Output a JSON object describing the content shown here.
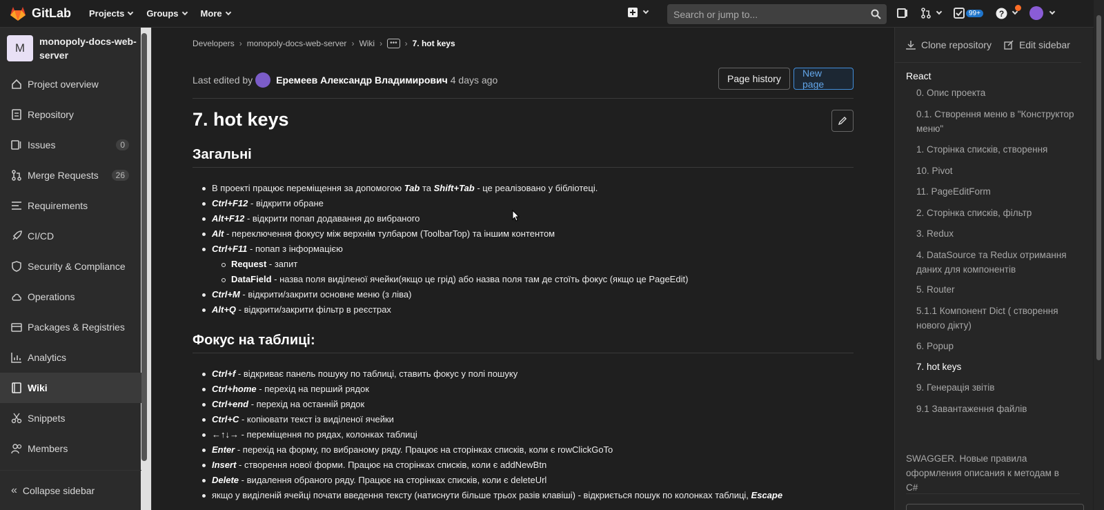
{
  "topbar": {
    "brand": "GitLab",
    "nav": [
      "Projects",
      "Groups",
      "More"
    ],
    "search_placeholder": "Search or jump to...",
    "todo_count": "99+"
  },
  "sidebar": {
    "project_initial": "M",
    "project_name": "monopoly-docs-web-server",
    "items": [
      {
        "label": "Project overview",
        "icon": "home-icon"
      },
      {
        "label": "Repository",
        "icon": "doc-icon"
      },
      {
        "label": "Issues",
        "icon": "issues-icon",
        "count": "0"
      },
      {
        "label": "Merge Requests",
        "icon": "merge-request-icon",
        "count": "26"
      },
      {
        "label": "Requirements",
        "icon": "requirements-icon"
      },
      {
        "label": "CI/CD",
        "icon": "rocket-icon"
      },
      {
        "label": "Security & Compliance",
        "icon": "shield-icon"
      },
      {
        "label": "Operations",
        "icon": "cloud-gear-icon"
      },
      {
        "label": "Packages & Registries",
        "icon": "package-icon"
      },
      {
        "label": "Analytics",
        "icon": "chart-icon"
      },
      {
        "label": "Wiki",
        "icon": "book-icon"
      },
      {
        "label": "Snippets",
        "icon": "scissors-icon"
      },
      {
        "label": "Members",
        "icon": "users-icon"
      }
    ],
    "collapse_label": "Collapse sidebar"
  },
  "breadcrumbs": {
    "items": [
      "Developers",
      "monopoly-docs-web-server",
      "Wiki"
    ],
    "current": "7. hot keys"
  },
  "page": {
    "edited_prefix": "Last edited by",
    "author": "Еремеев Александр Владимирович",
    "edited_time": "4 days ago",
    "history_btn": "Page history",
    "new_page_btn": "New page",
    "title": "7. hot keys"
  },
  "content": {
    "section1_title": "Загальні",
    "section1": [
      {
        "type": "mixed",
        "parts": [
          [
            "",
            "В проекті працює переміщення за допомогою "
          ],
          [
            "kb",
            "Tab"
          ],
          [
            "",
            " та "
          ],
          [
            "kb",
            "Shift+Tab"
          ],
          [
            "",
            " - це реалізовано у бібліотеці."
          ]
        ]
      },
      {
        "type": "mixed",
        "parts": [
          [
            "kb",
            "Ctrl+F12"
          ],
          [
            "",
            " - відкрити обране"
          ]
        ]
      },
      {
        "type": "mixed",
        "parts": [
          [
            "kb",
            "Alt+F12"
          ],
          [
            "",
            " - відкрити попап додавання до вибраного"
          ]
        ]
      },
      {
        "type": "mixed",
        "parts": [
          [
            "kb",
            "Alt"
          ],
          [
            "",
            " - переключення фокусу між верхнім тулбаром (ToolbarTop) та іншим контентом"
          ]
        ]
      },
      {
        "type": "mixed",
        "parts": [
          [
            "kb",
            "Ctrl+F11"
          ],
          [
            "",
            " - попап з інформацією"
          ]
        ]
      },
      {
        "type": "sub",
        "parts": [
          [
            "kbn",
            "Request"
          ],
          [
            "",
            " - запит"
          ]
        ]
      },
      {
        "type": "sub",
        "parts": [
          [
            "kbn",
            "DataField"
          ],
          [
            "",
            " - назва поля виділеної ячейки(якщо це грід) або назва поля там де стоїть фокус (якщо це PageEdit)"
          ]
        ]
      },
      {
        "type": "mixed",
        "parts": [
          [
            "kb",
            "Ctrl+M"
          ],
          [
            "",
            " - відкрити/закрити основне меню (з ліва)"
          ]
        ]
      },
      {
        "type": "mixed",
        "parts": [
          [
            "kb",
            "Alt+Q"
          ],
          [
            "",
            " - відкрити/закрити фільтр в реєстрах"
          ]
        ]
      }
    ],
    "section2_title": "Фокус на таблиці:",
    "section2": [
      {
        "type": "mixed",
        "parts": [
          [
            "kb",
            "Ctrl+f"
          ],
          [
            "",
            " - відкриває панель пошуку по таблиці, ставить фокус у полі пошуку"
          ]
        ]
      },
      {
        "type": "mixed",
        "parts": [
          [
            "kb",
            "Ctrl+home"
          ],
          [
            "",
            " - перехід на перший рядок"
          ]
        ]
      },
      {
        "type": "mixed",
        "parts": [
          [
            "kb",
            "Ctrl+end"
          ],
          [
            "",
            " - перехід на останній рядок"
          ]
        ]
      },
      {
        "type": "mixed",
        "parts": [
          [
            "kb",
            "Ctrl+C"
          ],
          [
            "",
            " - копіювати текст із виділеної ячейки"
          ]
        ]
      },
      {
        "type": "mixed",
        "parts": [
          [
            "",
            "←↑↓→ - переміщення по рядах, колонках таблиці"
          ]
        ]
      },
      {
        "type": "mixed",
        "parts": [
          [
            "kb",
            "Enter"
          ],
          [
            "",
            " - перехід на форму, по вибраному ряду. Працює на сторінках списків, коли є rowClickGoTo"
          ]
        ]
      },
      {
        "type": "mixed",
        "parts": [
          [
            "kb",
            "Insert"
          ],
          [
            "",
            " - створення нової форми. Працює на сторінках списків, коли є addNewBtn"
          ]
        ]
      },
      {
        "type": "mixed",
        "parts": [
          [
            "kb",
            "Delete"
          ],
          [
            "",
            " - видалення обраного ряду. Працює на сторінках списків, коли є deleteUrl"
          ]
        ]
      },
      {
        "type": "mixed",
        "parts": [
          [
            "",
            "якщо у виділеній ячейці почати введення тексту (натиснути більше трьох разів клавіші) - відкриється пошук по колонках таблиці, "
          ],
          [
            "kb",
            "Escape"
          ]
        ]
      }
    ]
  },
  "right_sidebar": {
    "clone_label": "Clone repository",
    "edit_label": "Edit sidebar",
    "section": "React",
    "items": [
      "0. Опис проекта",
      "0.1. Створення меню в \"Конструктор меню\"",
      "1. Сторінка списків, створення",
      "10. Pivot",
      "11. PageEditForm",
      "2. Сторінка списків, фільтр",
      "3. Redux",
      "4. DataSource та Redux отримання даних для компонентів",
      "5. Router",
      "5.1.1 Компонент Dict ( створення нового дікту)",
      "6. Popup",
      "7. hot keys",
      "9. Генерація звітів",
      "9.1 Завантаження файлів"
    ],
    "extra": "SWAGGER. Новые правила оформления описания к методам в C#",
    "active": "7. hot keys"
  },
  "colors": {
    "accent": "#428fdc",
    "brand_orange": "#fc6d26",
    "bg": "#1f1f1f"
  }
}
